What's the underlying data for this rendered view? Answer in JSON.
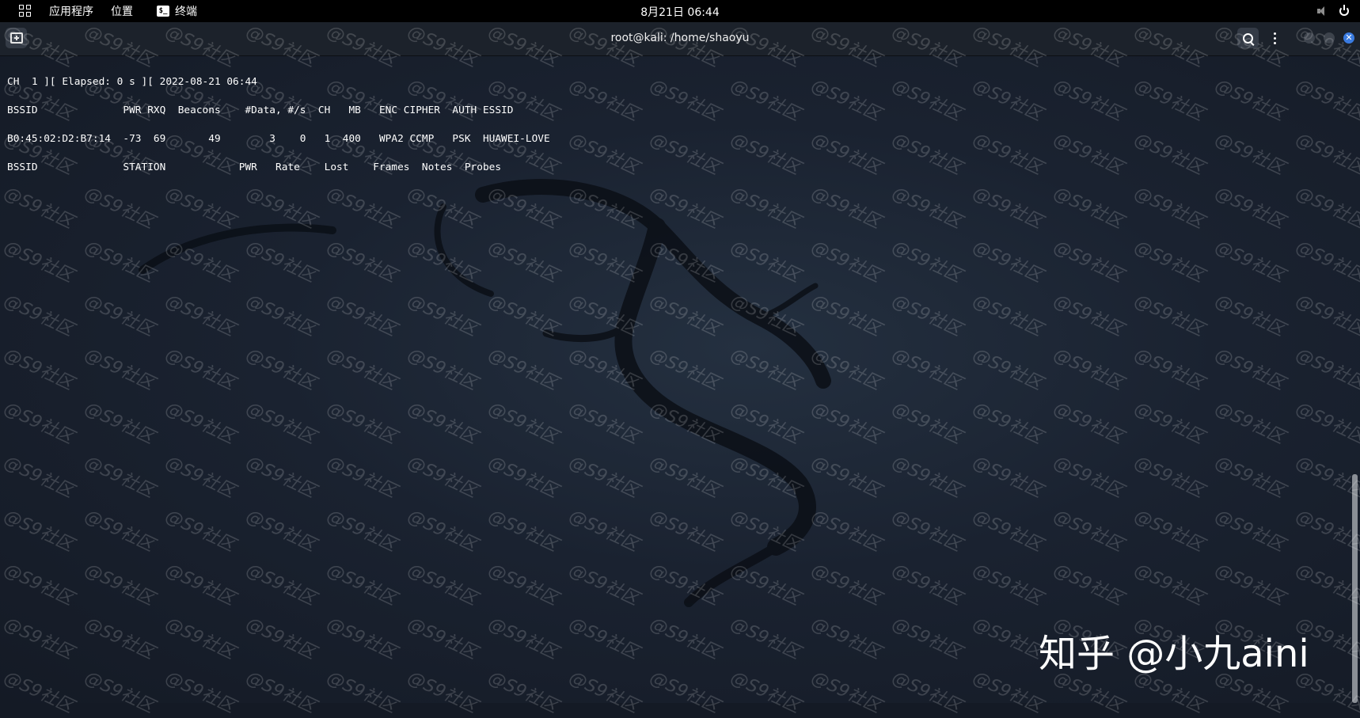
{
  "top_panel": {
    "apps_menu": "应用程序",
    "places_menu": "位置",
    "terminal_icon_glyph": "$_",
    "terminal_menu": "终端",
    "clock": "8月21日  06:44"
  },
  "window": {
    "title": "root@kali: /home/shaoyu",
    "close_glyph": "✕"
  },
  "terminal": {
    "lines": [
      "CH  1 ][ Elapsed: 0 s ][ 2022-08-21 06:44",
      "BSSID              PWR RXQ  Beacons    #Data, #/s  CH   MB   ENC CIPHER  AUTH ESSID",
      "B0:45:02:D2:B7:14  -73  69       49        3    0   1  400   WPA2 CCMP   PSK  HUAWEI-LOVE",
      "BSSID              STATION            PWR   Rate    Lost    Frames  Notes  Probes"
    ]
  },
  "watermark": {
    "text": "@S9社区",
    "credit": "知乎 @小九aini"
  }
}
